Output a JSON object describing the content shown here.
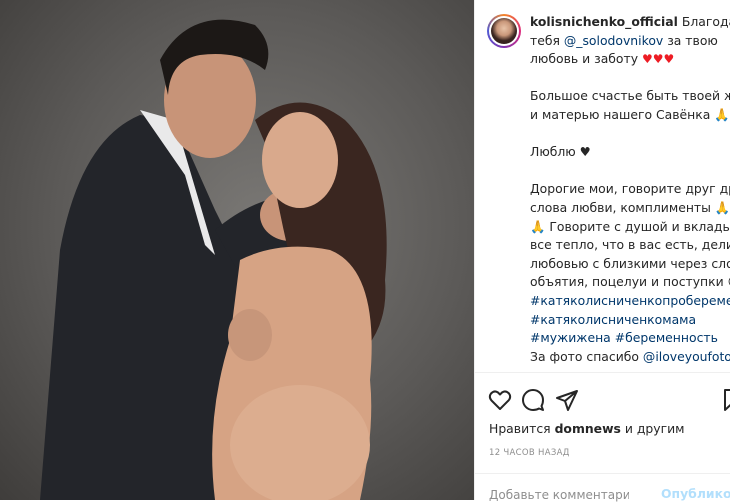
{
  "post": {
    "username": "kolisnichenko_official",
    "caption_lines": [
      {
        "pre": " Благодарю"
      },
      {
        "pre": "тебя ",
        "mention": "@_solodovnikov",
        "post": " за твою"
      },
      {
        "pre": "любовь и заботу ",
        "emoji": "♥♥♥"
      }
    ],
    "paragraphs": [
      [
        "Большое счастье быть твоей женой",
        "и матерью нашего Савёнка 🙏"
      ],
      [
        "Люблю ♥"
      ],
      [
        "Дорогие мои, говорите друг другу",
        "слова любви, комплименты 🙏🙏",
        "🙏 Говорите с душой и вкладывайте",
        "все тепло, что в вас есть, делитесь",
        "любовью с близкими через слова,",
        "объятия, поцелуи и поступки 😍"
      ]
    ],
    "hashtags": [
      "#катяколисниченкопробеременност",
      "#катяколисниченкомама",
      "#мужижена #беременность"
    ],
    "credit_pre": "За фото спасибо ",
    "credit_mention": "@iloveyoufoto"
  },
  "actions": {
    "like_icon": "heart-outline-icon",
    "comment_icon": "speech-bubble-icon",
    "share_icon": "paper-plane-icon",
    "save_icon": "bookmark-icon"
  },
  "likes": {
    "prefix": "Нравится ",
    "user": "domnews",
    "suffix": " и другим"
  },
  "timestamp": "12 ЧАСОВ НАЗАД",
  "comment": {
    "placeholder": "Добавьте комментарий...",
    "post_label": "Опубликовать"
  },
  "colors": {
    "link": "#00376b",
    "heart": "#ed1c24",
    "post_button": "#b2dffc",
    "muted": "#8e8e8e"
  }
}
